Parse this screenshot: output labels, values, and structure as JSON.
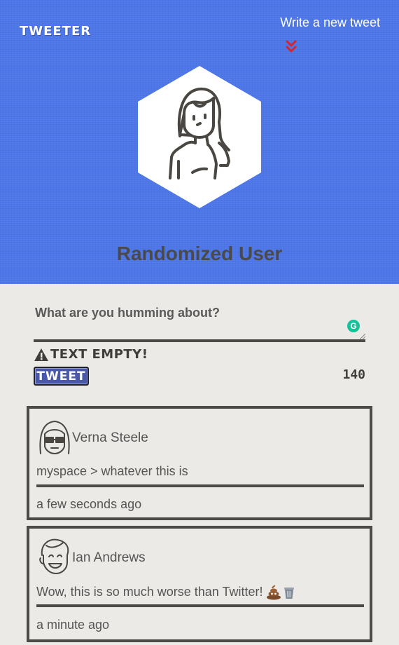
{
  "header": {
    "brand": "TWEETER",
    "write_link": "Write a new tweet",
    "user_name": "Randomized User",
    "bg_color": "#4d76e8"
  },
  "composer": {
    "placeholder": "What are you humming about?",
    "value": "",
    "warning": "TEXT EMPTY!",
    "tweet_button": "TWEET",
    "char_count": "140"
  },
  "tweets": [
    {
      "author": "Verna Steele",
      "content": "myspace > whatever this is",
      "time": "a few seconds ago",
      "avatar_icon": "girl-glasses-avatar-icon"
    },
    {
      "author": "Ian Andrews",
      "content": "Wow, this is so much worse than Twitter! ",
      "time": "a minute ago",
      "avatar_icon": "boy-laughing-avatar-icon",
      "emojis": [
        "poop-icon",
        "trash-icon"
      ]
    }
  ]
}
